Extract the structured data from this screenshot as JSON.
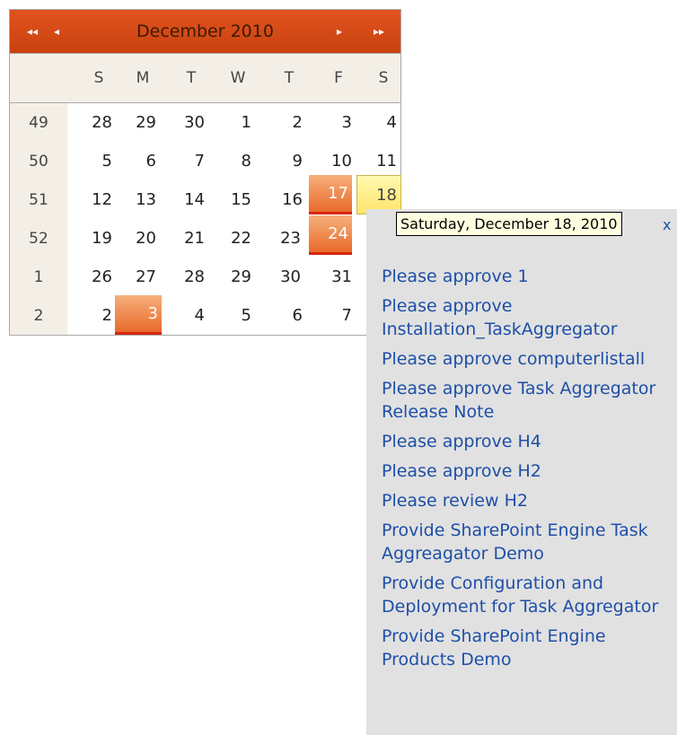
{
  "calendar": {
    "title": "December 2010",
    "nav": {
      "prev_year": "◂◂",
      "prev_month": "◂",
      "next_month": "▸",
      "next_year": "▸▸"
    },
    "weekday_labels": [
      "S",
      "M",
      "T",
      "W",
      "T",
      "F",
      "S"
    ],
    "weeks": [
      {
        "week": "49",
        "days": [
          "28",
          "29",
          "30",
          "1",
          "2",
          "3",
          "4"
        ]
      },
      {
        "week": "50",
        "days": [
          "5",
          "6",
          "7",
          "8",
          "9",
          "10",
          "11"
        ]
      },
      {
        "week": "51",
        "days": [
          "12",
          "13",
          "14",
          "15",
          "16",
          "17",
          "18"
        ]
      },
      {
        "week": "52",
        "days": [
          "19",
          "20",
          "21",
          "22",
          "23",
          "24",
          ""
        ]
      },
      {
        "week": "1",
        "days": [
          "26",
          "27",
          "28",
          "29",
          "30",
          "31",
          ""
        ]
      },
      {
        "week": "2",
        "days": [
          "2",
          "3",
          "4",
          "5",
          "6",
          "7",
          ""
        ]
      }
    ],
    "highlighted_days": [
      "17",
      "24",
      "3"
    ],
    "selected_day": "18"
  },
  "tooltip": {
    "text": "Saturday, December 18, 2010",
    "close_label": "x"
  },
  "tasks": [
    "Please approve 1",
    "Please approve Installation_TaskAggregator",
    "Please approve computerlistall",
    "Please approve Task Aggregator Release Note",
    "Please approve H4",
    "Please approve H2",
    "Please review H2",
    "Provide SharePoint Engine Task Aggreagator Demo",
    "Provide Configuration and Deployment for Task Aggregator",
    "Provide SharePoint Engine Products Demo"
  ],
  "colors": {
    "header": "#d34a15",
    "highlight": "#e86a2b",
    "selected": "#ffe46a",
    "link": "#1e4fa8",
    "panel": "#e1e1e1"
  }
}
